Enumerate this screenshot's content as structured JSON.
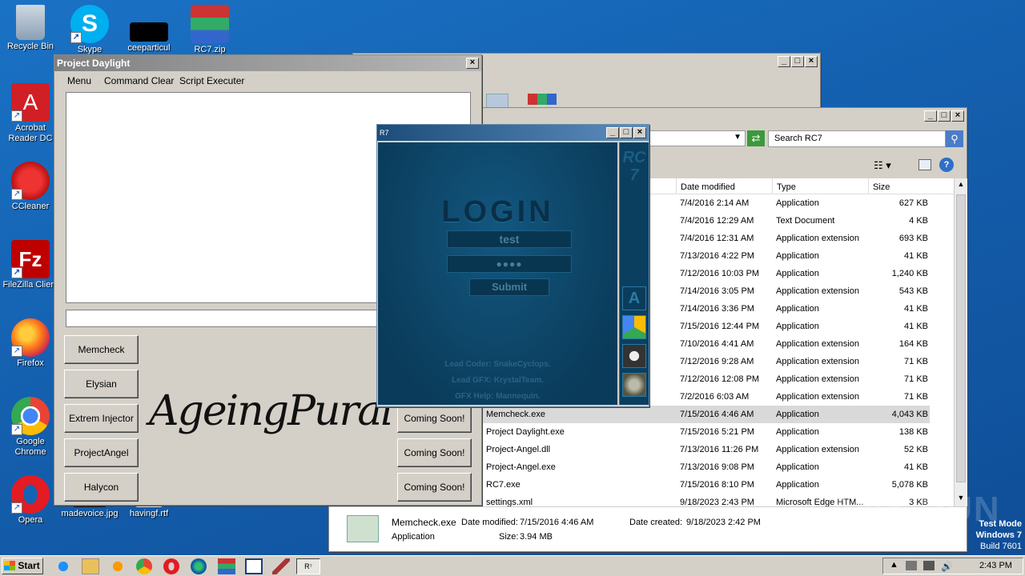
{
  "desktop": {
    "icons": [
      {
        "label": "Recycle Bin"
      },
      {
        "label": "Skype"
      },
      {
        "label": "ceeparticul"
      },
      {
        "label": "RC7.zip"
      },
      {
        "label": "Acrobat Reader DC"
      },
      {
        "label": "CCleaner"
      },
      {
        "label": "FileZilla Client"
      },
      {
        "label": "Firefox"
      },
      {
        "label": "Google Chrome"
      },
      {
        "label": "Opera"
      },
      {
        "label": "madevoice.jpg"
      },
      {
        "label": "havingf.rtf"
      }
    ],
    "watermark": {
      "text": "ANY RUN",
      "line1": "Test Mode",
      "line2": "Windows 7",
      "line3": "Build 7601"
    }
  },
  "project_daylight": {
    "title": "Project Daylight",
    "menu": [
      "Menu",
      "Command Clear",
      "Script Executer"
    ],
    "left_buttons": [
      "Memcheck",
      "Elysian",
      "Extrem Injector",
      "ProjectAngel",
      "Halycon"
    ],
    "right_buttons": [
      "Coming Soon!",
      "Coming Soon!",
      "Coming Soon!"
    ],
    "signature": "AgeingPural"
  },
  "rc7": {
    "title": "R7",
    "heading": "LOGIN",
    "username": "test",
    "password": "●●●●",
    "submit": "Submit",
    "side_brand": "RC7",
    "credits": [
      "Lead Coder: SnakeCyclops.",
      "Lead GFX: KrystalTeam.",
      "GFX Help: Mannequin."
    ]
  },
  "explorer": {
    "search_placeholder": "Search RC7",
    "columns": [
      "Date modified",
      "Type",
      "Size"
    ],
    "rows": [
      {
        "name": "",
        "date": "7/4/2016 2:14 AM",
        "type": "Application",
        "size": "627 KB"
      },
      {
        "name": "",
        "date": "7/4/2016 12:29 AM",
        "type": "Text Document",
        "size": "4 KB"
      },
      {
        "name": "",
        "date": "7/4/2016 12:31 AM",
        "type": "Application extension",
        "size": "693 KB"
      },
      {
        "name": "",
        "date": "7/13/2016 4:22 PM",
        "type": "Application",
        "size": "41 KB"
      },
      {
        "name": "",
        "date": "7/12/2016 10:03 PM",
        "type": "Application",
        "size": "1,240 KB"
      },
      {
        "name": "",
        "date": "7/14/2016 3:05 PM",
        "type": "Application extension",
        "size": "543 KB"
      },
      {
        "name": "",
        "date": "7/14/2016 3:36 PM",
        "type": "Application",
        "size": "41 KB"
      },
      {
        "name": "",
        "date": "7/15/2016 12:44 PM",
        "type": "Application",
        "size": "41 KB"
      },
      {
        "name": "",
        "date": "7/10/2016 4:41 AM",
        "type": "Application extension",
        "size": "164 KB"
      },
      {
        "name": "",
        "date": "7/12/2016 9:28 AM",
        "type": "Application extension",
        "size": "71 KB"
      },
      {
        "name": "",
        "date": "7/12/2016 12:08 PM",
        "type": "Application extension",
        "size": "71 KB"
      },
      {
        "name": "",
        "date": "7/2/2016 6:03 AM",
        "type": "Application extension",
        "size": "71 KB"
      },
      {
        "name": "Memcheck.exe",
        "date": "7/15/2016 4:46 AM",
        "type": "Application",
        "size": "4,043 KB"
      },
      {
        "name": "Project Daylight.exe",
        "date": "7/15/2016 5:21 PM",
        "type": "Application",
        "size": "138 KB"
      },
      {
        "name": "Project-Angel.dll",
        "date": "7/13/2016 11:26 PM",
        "type": "Application extension",
        "size": "52 KB"
      },
      {
        "name": "Project-Angel.exe",
        "date": "7/13/2016 9:08 PM",
        "type": "Application",
        "size": "41 KB"
      },
      {
        "name": "RC7.exe",
        "date": "7/15/2016 8:10 PM",
        "type": "Application",
        "size": "5,078 KB"
      },
      {
        "name": "settings.xml",
        "date": "9/18/2023 2:43 PM",
        "type": "Microsoft Edge HTM...",
        "size": "3 KB"
      }
    ],
    "details": {
      "name": "Memcheck.exe",
      "modified_label": "Date modified:",
      "modified": "7/15/2016 4:46 AM",
      "created_label": "Date created:",
      "created": "9/18/2023 2:42 PM",
      "type": "Application",
      "size_label": "Size:",
      "size": "3.94 MB"
    }
  },
  "taskbar": {
    "start": "Start",
    "clock": "2:43 PM"
  }
}
